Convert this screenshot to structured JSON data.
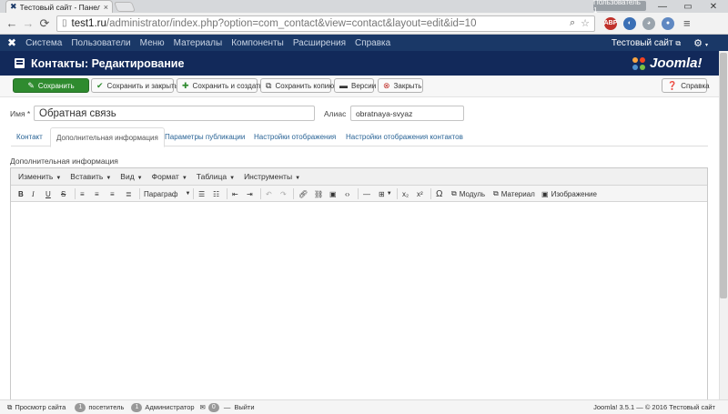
{
  "browser": {
    "tab_title": "Тестовый сайт - Панель",
    "tab_close": "×",
    "user_badge": "Пользователь 1",
    "url_host": "test1.ru",
    "url_path": "/administrator/index.php?option=com_contact&view=contact&layout=edit&id=10",
    "ext_abp": "ABP"
  },
  "topnav": {
    "items": [
      "Система",
      "Пользователи",
      "Меню",
      "Материалы",
      "Компоненты",
      "Расширения",
      "Справка"
    ],
    "site_link": "Тестовый сайт"
  },
  "title": "Контакты: Редактирование",
  "brand": "Joomla!",
  "toolbar": {
    "save": "Сохранить",
    "save_close": "Сохранить и закрыть",
    "save_new": "Сохранить и создать",
    "save_copy": "Сохранить копию",
    "versions": "Версии",
    "close": "Закрыть",
    "help": "Справка"
  },
  "form": {
    "name_label": "Имя *",
    "name_value": "Обратная связь",
    "alias_label": "Алиас",
    "alias_value": "obratnaya-svyaz"
  },
  "tabs": [
    "Контакт",
    "Дополнительная информация",
    "Параметры публикации",
    "Настройки отображения",
    "Настройки отображения контактов"
  ],
  "section_label": "Дополнительная информация",
  "editor": {
    "menus": [
      "Изменить",
      "Вставить",
      "Вид",
      "Формат",
      "Таблица",
      "Инструменты"
    ],
    "paragraph": "Параграф",
    "module": "Модуль",
    "article": "Материал",
    "image": "Изображение"
  },
  "status": {
    "view_site": "Просмотр сайта",
    "visitors_count": "1",
    "visitors_label": "посетитель",
    "admins_count": "1",
    "admins_label": "Администратор",
    "messages_count": "0",
    "logout": "Выйти",
    "version": "Joomla! 3.5.1 — © 2016 Тестовый сайт"
  },
  "colors": {
    "nav_bg": "#1a3867",
    "title_bg": "#12295a",
    "save_green": "#2f8b2f",
    "link_blue": "#2a6496"
  }
}
